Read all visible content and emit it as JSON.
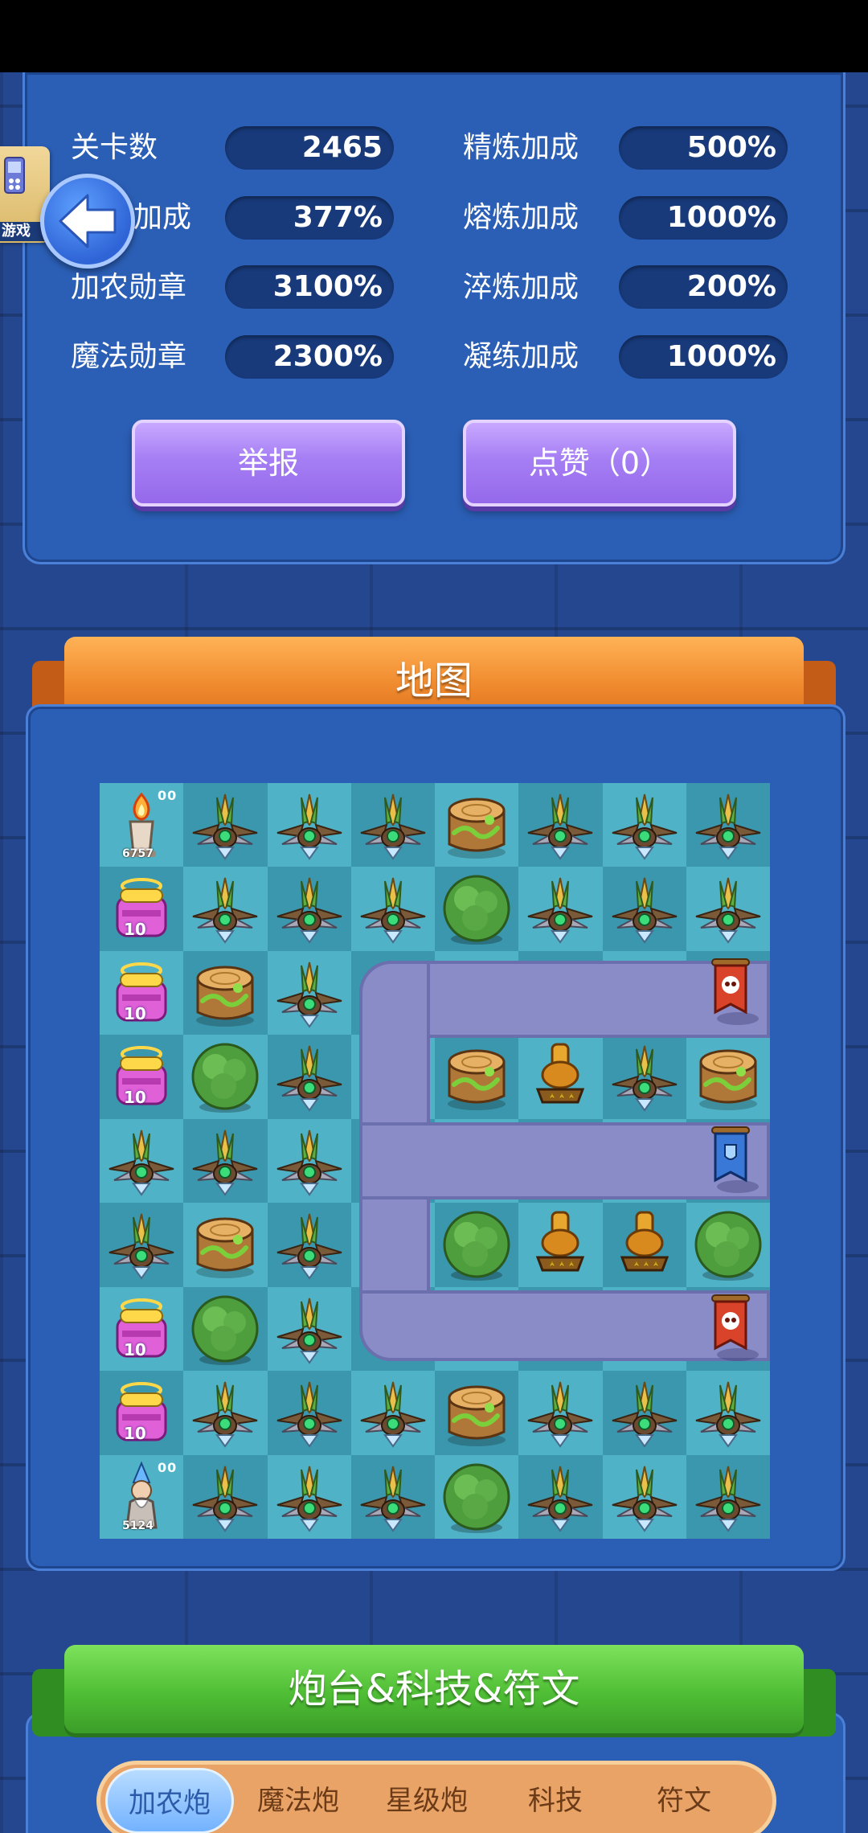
{
  "stats": [
    {
      "label": "关卡数",
      "value": "2465"
    },
    {
      "label": "加成",
      "value": "377%"
    },
    {
      "label": "加农勋章",
      "value": "3100%"
    },
    {
      "label": "魔法勋章",
      "value": "2300%"
    },
    {
      "label": "精炼加成",
      "value": "500%"
    },
    {
      "label": "熔炼加成",
      "value": "1000%"
    },
    {
      "label": "淬炼加成",
      "value": "200%"
    },
    {
      "label": "凝练加成",
      "value": "1000%"
    }
  ],
  "buttons": {
    "report": "举报",
    "like": "点赞（0）"
  },
  "game_badge": "游戏",
  "map_title": "地图",
  "map_grid": [
    [
      "candle",
      "plant",
      "plant",
      "plant",
      "stump",
      "plant",
      "plant",
      "plant"
    ],
    [
      "gift",
      "plant",
      "plant",
      "plant",
      "bush",
      "plant",
      "plant",
      "plant"
    ],
    [
      "gift",
      "stump",
      "plant",
      "",
      "",
      "",
      "",
      "flag-red"
    ],
    [
      "gift",
      "bush",
      "plant",
      "",
      "stump",
      "cannon",
      "plant",
      "stump"
    ],
    [
      "plant",
      "plant",
      "plant",
      "",
      "",
      "",
      "",
      "flag-blue"
    ],
    [
      "plant",
      "stump",
      "plant",
      "",
      "bush",
      "cannon",
      "cannon",
      "bush"
    ],
    [
      "gift",
      "bush",
      "plant",
      "",
      "",
      "",
      "",
      "flag-red"
    ],
    [
      "gift",
      "plant",
      "plant",
      "plant",
      "stump",
      "plant",
      "plant",
      "plant"
    ],
    [
      "wizard",
      "plant",
      "plant",
      "plant",
      "bush",
      "plant",
      "plant",
      "plant"
    ]
  ],
  "map_labels": {
    "candle_hp": "6757",
    "candle_marks": "00",
    "wizard_hp": "5124",
    "wizard_marks": "00",
    "gift_level": "10"
  },
  "tower_title": "炮台&科技&符文",
  "tabs": [
    "加农炮",
    "魔法炮",
    "星级炮",
    "科技",
    "符文"
  ],
  "active_tab": "加农炮",
  "colors": {
    "panel": "#2b5fb6",
    "value_bg": "#183a7a",
    "button_purple": "#a57ef4",
    "ribbon_orange": "#f08a2e",
    "ribbon_green": "#4fbe35"
  }
}
